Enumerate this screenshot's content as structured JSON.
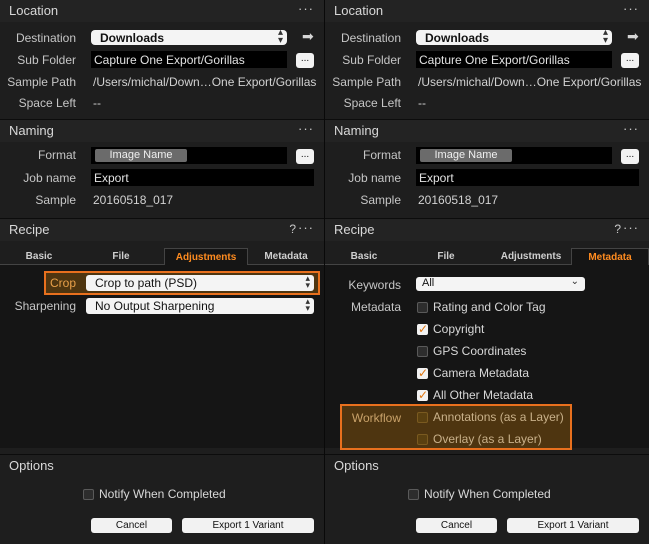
{
  "left": {
    "location": {
      "title": "Location",
      "more": "···",
      "destination_label": "Destination",
      "destination_value": "Downloads",
      "subfolder_label": "Sub Folder",
      "subfolder_value": "Capture One Export/Gorillas",
      "subfolder_btn": "...",
      "sample_path_label": "Sample Path",
      "sample_path_value": "/Users/michal/Down…One Export/Gorillas",
      "space_left_label": "Space Left",
      "space_left_value": "--"
    },
    "naming": {
      "title": "Naming",
      "more": "···",
      "format_label": "Format",
      "format_token": "Image Name",
      "format_btn": "...",
      "job_label": "Job name",
      "job_value": "Export",
      "sample_label": "Sample",
      "sample_value": "20160518_017"
    },
    "recipe": {
      "title": "Recipe",
      "help": "?",
      "more": "···",
      "tabs": [
        "Basic",
        "File",
        "Adjustments",
        "Metadata"
      ],
      "active_tab": "Adjustments",
      "crop_label": "Crop",
      "crop_value": "Crop to path (PSD)",
      "sharpening_label": "Sharpening",
      "sharpening_value": "No Output Sharpening"
    },
    "options": {
      "title": "Options",
      "notify_label": "Notify When Completed",
      "notify_checked": false,
      "cancel_label": "Cancel",
      "export_label": "Export 1 Variant"
    }
  },
  "right": {
    "location": {
      "title": "Location",
      "more": "···",
      "destination_label": "Destination",
      "destination_value": "Downloads",
      "subfolder_label": "Sub Folder",
      "subfolder_value": "Capture One Export/Gorillas",
      "subfolder_btn": "...",
      "sample_path_label": "Sample Path",
      "sample_path_value": "/Users/michal/Down…One Export/Gorillas",
      "space_left_label": "Space Left",
      "space_left_value": "--"
    },
    "naming": {
      "title": "Naming",
      "more": "···",
      "format_label": "Format",
      "format_token": "Image Name",
      "format_btn": "...",
      "job_label": "Job name",
      "job_value": "Export",
      "sample_label": "Sample",
      "sample_value": "20160518_017"
    },
    "recipe": {
      "title": "Recipe",
      "help": "?",
      "more": "···",
      "tabs": [
        "Basic",
        "File",
        "Adjustments",
        "Metadata"
      ],
      "active_tab": "Metadata",
      "keywords_label": "Keywords",
      "keywords_value": "All",
      "metadata_label": "Metadata",
      "workflow_label": "Workflow",
      "metadata_items": [
        {
          "label": "Rating and Color Tag",
          "checked": false
        },
        {
          "label": "Copyright",
          "checked": true
        },
        {
          "label": "GPS Coordinates",
          "checked": false
        },
        {
          "label": "Camera Metadata",
          "checked": true
        },
        {
          "label": "All Other Metadata",
          "checked": true
        }
      ],
      "workflow_items": [
        {
          "label": "Annotations (as a Layer)",
          "checked": false
        },
        {
          "label": "Overlay (as a Layer)",
          "checked": false
        }
      ]
    },
    "options": {
      "title": "Options",
      "notify_label": "Notify When Completed",
      "notify_checked": false,
      "cancel_label": "Cancel",
      "export_label": "Export 1 Variant"
    }
  },
  "colors": {
    "accent": "#ff8c20",
    "highlight_border": "#e8701e",
    "panel_bg": "#1e1e1e",
    "recipe_bg": "#151515"
  },
  "icons": {
    "more": "more-dots-icon",
    "arrow": "arrow-right-icon",
    "chevron": "updown-chevron-icon"
  }
}
